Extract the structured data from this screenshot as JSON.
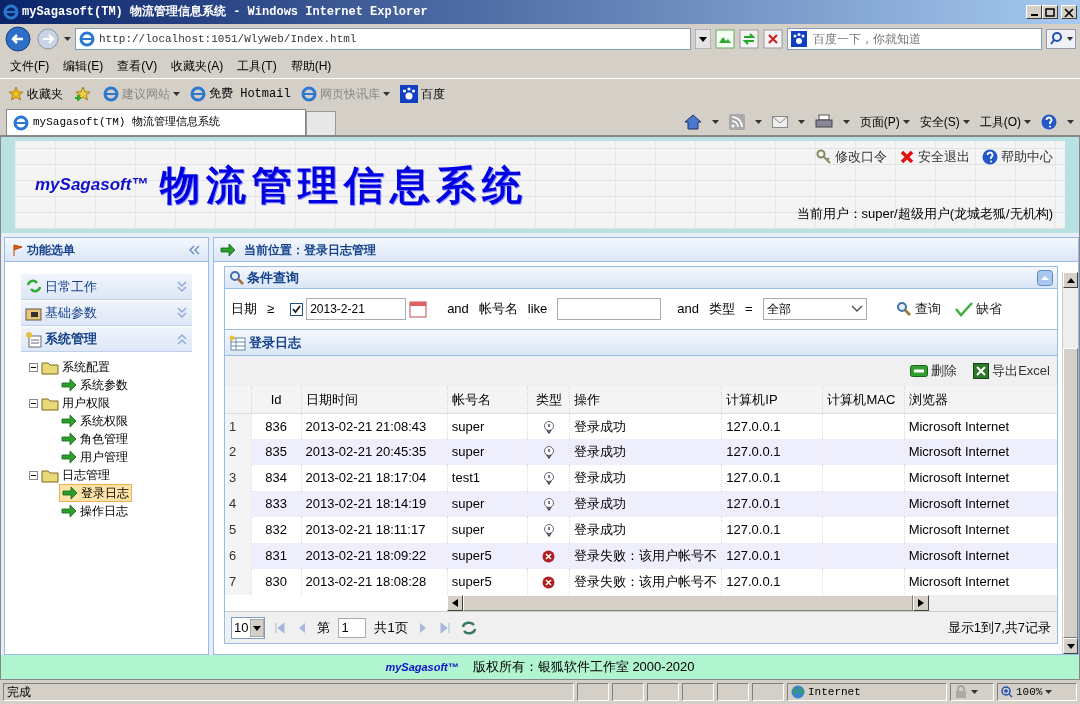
{
  "window": {
    "title": "mySagasoft(TM) 物流管理信息系统 - Windows Internet Explorer"
  },
  "address_bar": {
    "url": "http://localhost:1051/WlyWeb/Index.html"
  },
  "search_box": {
    "placeholder": "百度一下，你就知道"
  },
  "menu_bar": [
    "文件(F)",
    "编辑(E)",
    "查看(V)",
    "收藏夹(A)",
    "工具(T)",
    "帮助(H)"
  ],
  "favorites_bar": {
    "title": "收藏夹",
    "items": [
      {
        "label": "建议网站",
        "disabled": true,
        "dropdown": true
      },
      {
        "label": "免费 Hotmail",
        "disabled": false,
        "dropdown": false
      },
      {
        "label": "网页快讯库",
        "disabled": true,
        "dropdown": true
      },
      {
        "label": "百度",
        "disabled": false,
        "dropdown": false
      }
    ]
  },
  "browser_tab": {
    "label": "mySagasoft(TM) 物流管理信息系统"
  },
  "command_bar": [
    "页面(P)",
    "安全(S)",
    "工具(O)"
  ],
  "header": {
    "logo": "mySagasoft™",
    "title": "物流管理信息系统",
    "links": [
      "修改口令",
      "安全退出",
      "帮助中心"
    ],
    "current_user": "当前用户：super/超级用户(龙城老狐/无机构)"
  },
  "sidebar": {
    "title": "功能选单",
    "sections": [
      {
        "label": "日常工作",
        "expanded": false
      },
      {
        "label": "基础参数",
        "expanded": false
      },
      {
        "label": "系统管理",
        "expanded": true
      }
    ],
    "tree": [
      {
        "label": "系统配置",
        "expanded": true,
        "children": [
          {
            "label": "系统参数",
            "selected": false
          }
        ]
      },
      {
        "label": "用户权限",
        "expanded": true,
        "children": [
          {
            "label": "系统权限",
            "selected": false
          },
          {
            "label": "角色管理",
            "selected": false
          },
          {
            "label": "用户管理",
            "selected": false
          }
        ]
      },
      {
        "label": "日志管理",
        "expanded": true,
        "children": [
          {
            "label": "登录日志",
            "selected": true
          },
          {
            "label": "操作日志",
            "selected": false
          }
        ]
      }
    ]
  },
  "breadcrumb": "当前位置：登录日志管理",
  "query_panel": {
    "title": "条件查询",
    "date_label": "日期",
    "date_operator": "≥",
    "date_enabled": true,
    "date": "2013-2-21",
    "and_1": "and",
    "account_label": "帐号名",
    "account_operator": "like",
    "and_2": "and",
    "type_label": "类型",
    "type_operator": "=",
    "type": "全部",
    "buttons": [
      "查询",
      "缺省"
    ]
  },
  "log_panel": {
    "title": "登录日志",
    "toolbar": [
      "删除",
      "导出Excel"
    ],
    "columns": [
      "Id",
      "日期时间",
      "帐号名",
      "类型",
      "操作",
      "计算机IP",
      "计算机MAC",
      "浏览器"
    ],
    "rows": [
      {
        "index": "1",
        "id": "836",
        "datetime": "2013-02-21 21:08:43",
        "account": "super",
        "kind": "success",
        "operation": "登录成功",
        "ip": "127.0.0.1",
        "browser": "Microsoft Internet"
      },
      {
        "index": "2",
        "id": "835",
        "datetime": "2013-02-21 20:45:35",
        "account": "super",
        "kind": "success",
        "operation": "登录成功",
        "ip": "127.0.0.1",
        "browser": "Microsoft Internet"
      },
      {
        "index": "3",
        "id": "834",
        "datetime": "2013-02-21 18:17:04",
        "account": "test1",
        "kind": "success",
        "operation": "登录成功",
        "ip": "127.0.0.1",
        "browser": "Microsoft Internet"
      },
      {
        "index": "4",
        "id": "833",
        "datetime": "2013-02-21 18:14:19",
        "account": "super",
        "kind": "success",
        "operation": "登录成功",
        "ip": "127.0.0.1",
        "browser": "Microsoft Internet"
      },
      {
        "index": "5",
        "id": "832",
        "datetime": "2013-02-21 18:11:17",
        "account": "super",
        "kind": "success",
        "operation": "登录成功",
        "ip": "127.0.0.1",
        "browser": "Microsoft Internet"
      },
      {
        "index": "6",
        "id": "831",
        "datetime": "2013-02-21 18:09:22",
        "account": "super5",
        "kind": "failure",
        "operation": "登录失败：该用户帐号不",
        "ip": "127.0.0.1",
        "browser": "Microsoft Internet"
      },
      {
        "index": "7",
        "id": "830",
        "datetime": "2013-02-21 18:08:28",
        "account": "super5",
        "kind": "failure",
        "operation": "登录失败：该用户帐号不",
        "ip": "127.0.0.1",
        "browser": "Microsoft Internet"
      }
    ],
    "pager": {
      "page_size": "10",
      "page_label": "第",
      "page": "1",
      "total_pages": "共1页",
      "summary": "显示1到7,共7记录"
    }
  },
  "footer": {
    "logo": "mySagasoft™",
    "text": "版权所有：银狐软件工作室 2000-2020"
  },
  "status_bar": {
    "text": "完成",
    "zone": "Internet",
    "zoom": "100%"
  }
}
